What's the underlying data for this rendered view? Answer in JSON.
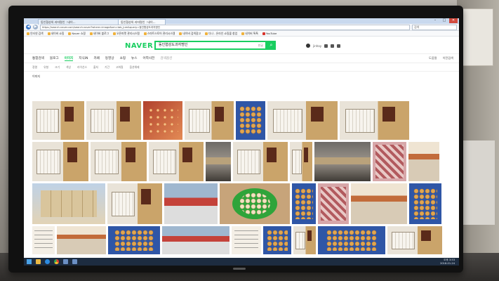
{
  "browser": {
    "tabs": [
      {
        "label": "동인협성의 과자명인 : 네이…"
      },
      {
        "label": "동인협성의 과자명인 : 네이…"
      }
    ],
    "window_buttons": {
      "minimize": "–",
      "maximize": "□",
      "close": "✕"
    },
    "url": "https://search.naver.com/search.naver?where=image&sm=tab_jum&query=동인협성도과자명인",
    "search_placeholder": "검색",
    "bookmarks": [
      {
        "label": "인터넷 검색"
      },
      {
        "label": "네이버 쇼핑"
      },
      {
        "label": "Naver 쇼핑"
      },
      {
        "label": "네이버 블로그"
      },
      {
        "label": "오픈마켓 관리시스템"
      },
      {
        "label": "스마트스토어 관리시스템"
      },
      {
        "label": "네이버 검색광고"
      },
      {
        "label": "다나 - 온라인 쇼핑몰 창업"
      },
      {
        "label": "네이버 톡톡"
      },
      {
        "label": "YouTube"
      }
    ]
  },
  "naver": {
    "logo": "NAVER",
    "query": "동인협성도과자명인",
    "keyboard_hint": "한글",
    "search_button": "⌕",
    "user_name": "jinhay"
  },
  "lnb": {
    "tabs": [
      "통합검색",
      "블로그",
      "이미지",
      "지식iN",
      "카페",
      "동영상",
      "쇼핑",
      "뉴스",
      "어학사전"
    ],
    "active_index": 2,
    "options_label": "검색옵션",
    "right": [
      "도움말",
      "이전검색"
    ]
  },
  "filters": [
    "정렬",
    "유형",
    "크기",
    "색상",
    "라이선스",
    "출처",
    "기간",
    "고화질",
    "옵션해제"
  ],
  "section_label": "이미지",
  "taskbar": {
    "time": "오후 3:53",
    "date": "2018-01-24"
  }
}
